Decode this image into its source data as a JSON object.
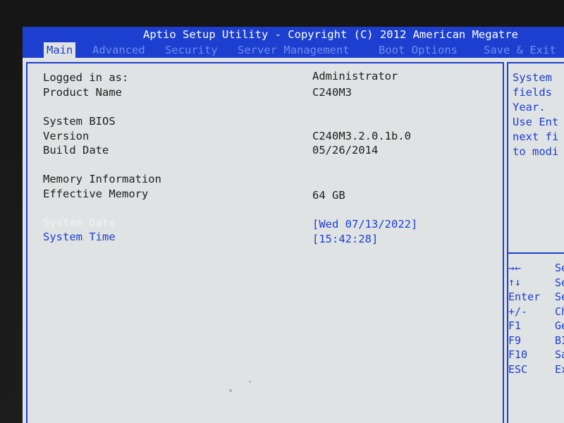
{
  "title": "Aptio Setup Utility - Copyright (C) 2012 American Megatre",
  "tabs": [
    {
      "label": "Main",
      "active": true
    },
    {
      "label": "Advanced",
      "active": false
    },
    {
      "label": "Security",
      "active": false
    },
    {
      "label": "Server Management",
      "active": false
    },
    {
      "label": "Boot Options",
      "active": false
    },
    {
      "label": "Save & Exit",
      "active": false
    }
  ],
  "main": {
    "logged_in_label": "Logged in as:",
    "logged_in_value": "Administrator",
    "product_name_label": "Product Name",
    "product_name_value": "C240M3",
    "system_bios_heading": "System BIOS",
    "version_label": "Version",
    "version_value": "C240M3.2.0.1b.0",
    "build_date_label": "Build Date",
    "build_date_value": "05/26/2014",
    "memory_heading": "Memory Information",
    "effective_memory_label": "Effective Memory",
    "effective_memory_value": "64 GB",
    "system_date_label": "System Date",
    "system_date_value": "[Wed 07/13/2022]",
    "system_time_label": "System Time",
    "system_time_value": "[15:42:28]"
  },
  "help": {
    "lines": [
      "System",
      "fields",
      "Year.",
      "Use Ent",
      "next fi",
      "to modi"
    ]
  },
  "keys": [
    {
      "key": "→←",
      "desc": "Se"
    },
    {
      "key": "↑↓",
      "desc": "Se"
    },
    {
      "key": "Enter",
      "desc": "Se"
    },
    {
      "key": "+/-",
      "desc": "Ch"
    },
    {
      "key": "F1",
      "desc": "Ge"
    },
    {
      "key": "F9",
      "desc": "BI"
    },
    {
      "key": "F10",
      "desc": "Sa"
    },
    {
      "key": "ESC",
      "desc": "Ex"
    }
  ],
  "colors": {
    "bios_blue": "#1d3fcf",
    "panel_background": "#dfe3e3",
    "selected_text": "#f2f2f2"
  }
}
